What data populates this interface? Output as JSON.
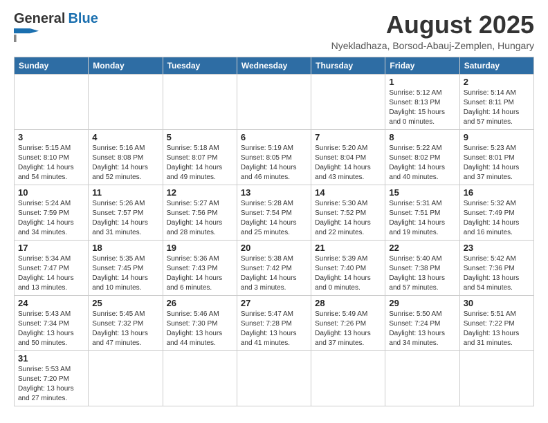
{
  "header": {
    "logo_general": "General",
    "logo_blue": "Blue",
    "month_year": "August 2025",
    "location": "Nyekladhaza, Borsod-Abauj-Zemplen, Hungary"
  },
  "days_of_week": [
    "Sunday",
    "Monday",
    "Tuesday",
    "Wednesday",
    "Thursday",
    "Friday",
    "Saturday"
  ],
  "weeks": [
    [
      {
        "day": "",
        "info": ""
      },
      {
        "day": "",
        "info": ""
      },
      {
        "day": "",
        "info": ""
      },
      {
        "day": "",
        "info": ""
      },
      {
        "day": "",
        "info": ""
      },
      {
        "day": "1",
        "info": "Sunrise: 5:12 AM\nSunset: 8:13 PM\nDaylight: 15 hours and 0 minutes."
      },
      {
        "day": "2",
        "info": "Sunrise: 5:14 AM\nSunset: 8:11 PM\nDaylight: 14 hours and 57 minutes."
      }
    ],
    [
      {
        "day": "3",
        "info": "Sunrise: 5:15 AM\nSunset: 8:10 PM\nDaylight: 14 hours and 54 minutes."
      },
      {
        "day": "4",
        "info": "Sunrise: 5:16 AM\nSunset: 8:08 PM\nDaylight: 14 hours and 52 minutes."
      },
      {
        "day": "5",
        "info": "Sunrise: 5:18 AM\nSunset: 8:07 PM\nDaylight: 14 hours and 49 minutes."
      },
      {
        "day": "6",
        "info": "Sunrise: 5:19 AM\nSunset: 8:05 PM\nDaylight: 14 hours and 46 minutes."
      },
      {
        "day": "7",
        "info": "Sunrise: 5:20 AM\nSunset: 8:04 PM\nDaylight: 14 hours and 43 minutes."
      },
      {
        "day": "8",
        "info": "Sunrise: 5:22 AM\nSunset: 8:02 PM\nDaylight: 14 hours and 40 minutes."
      },
      {
        "day": "9",
        "info": "Sunrise: 5:23 AM\nSunset: 8:01 PM\nDaylight: 14 hours and 37 minutes."
      }
    ],
    [
      {
        "day": "10",
        "info": "Sunrise: 5:24 AM\nSunset: 7:59 PM\nDaylight: 14 hours and 34 minutes."
      },
      {
        "day": "11",
        "info": "Sunrise: 5:26 AM\nSunset: 7:57 PM\nDaylight: 14 hours and 31 minutes."
      },
      {
        "day": "12",
        "info": "Sunrise: 5:27 AM\nSunset: 7:56 PM\nDaylight: 14 hours and 28 minutes."
      },
      {
        "day": "13",
        "info": "Sunrise: 5:28 AM\nSunset: 7:54 PM\nDaylight: 14 hours and 25 minutes."
      },
      {
        "day": "14",
        "info": "Sunrise: 5:30 AM\nSunset: 7:52 PM\nDaylight: 14 hours and 22 minutes."
      },
      {
        "day": "15",
        "info": "Sunrise: 5:31 AM\nSunset: 7:51 PM\nDaylight: 14 hours and 19 minutes."
      },
      {
        "day": "16",
        "info": "Sunrise: 5:32 AM\nSunset: 7:49 PM\nDaylight: 14 hours and 16 minutes."
      }
    ],
    [
      {
        "day": "17",
        "info": "Sunrise: 5:34 AM\nSunset: 7:47 PM\nDaylight: 14 hours and 13 minutes."
      },
      {
        "day": "18",
        "info": "Sunrise: 5:35 AM\nSunset: 7:45 PM\nDaylight: 14 hours and 10 minutes."
      },
      {
        "day": "19",
        "info": "Sunrise: 5:36 AM\nSunset: 7:43 PM\nDaylight: 14 hours and 6 minutes."
      },
      {
        "day": "20",
        "info": "Sunrise: 5:38 AM\nSunset: 7:42 PM\nDaylight: 14 hours and 3 minutes."
      },
      {
        "day": "21",
        "info": "Sunrise: 5:39 AM\nSunset: 7:40 PM\nDaylight: 14 hours and 0 minutes."
      },
      {
        "day": "22",
        "info": "Sunrise: 5:40 AM\nSunset: 7:38 PM\nDaylight: 13 hours and 57 minutes."
      },
      {
        "day": "23",
        "info": "Sunrise: 5:42 AM\nSunset: 7:36 PM\nDaylight: 13 hours and 54 minutes."
      }
    ],
    [
      {
        "day": "24",
        "info": "Sunrise: 5:43 AM\nSunset: 7:34 PM\nDaylight: 13 hours and 50 minutes."
      },
      {
        "day": "25",
        "info": "Sunrise: 5:45 AM\nSunset: 7:32 PM\nDaylight: 13 hours and 47 minutes."
      },
      {
        "day": "26",
        "info": "Sunrise: 5:46 AM\nSunset: 7:30 PM\nDaylight: 13 hours and 44 minutes."
      },
      {
        "day": "27",
        "info": "Sunrise: 5:47 AM\nSunset: 7:28 PM\nDaylight: 13 hours and 41 minutes."
      },
      {
        "day": "28",
        "info": "Sunrise: 5:49 AM\nSunset: 7:26 PM\nDaylight: 13 hours and 37 minutes."
      },
      {
        "day": "29",
        "info": "Sunrise: 5:50 AM\nSunset: 7:24 PM\nDaylight: 13 hours and 34 minutes."
      },
      {
        "day": "30",
        "info": "Sunrise: 5:51 AM\nSunset: 7:22 PM\nDaylight: 13 hours and 31 minutes."
      }
    ],
    [
      {
        "day": "31",
        "info": "Sunrise: 5:53 AM\nSunset: 7:20 PM\nDaylight: 13 hours and 27 minutes."
      },
      {
        "day": "",
        "info": ""
      },
      {
        "day": "",
        "info": ""
      },
      {
        "day": "",
        "info": ""
      },
      {
        "day": "",
        "info": ""
      },
      {
        "day": "",
        "info": ""
      },
      {
        "day": "",
        "info": ""
      }
    ]
  ]
}
